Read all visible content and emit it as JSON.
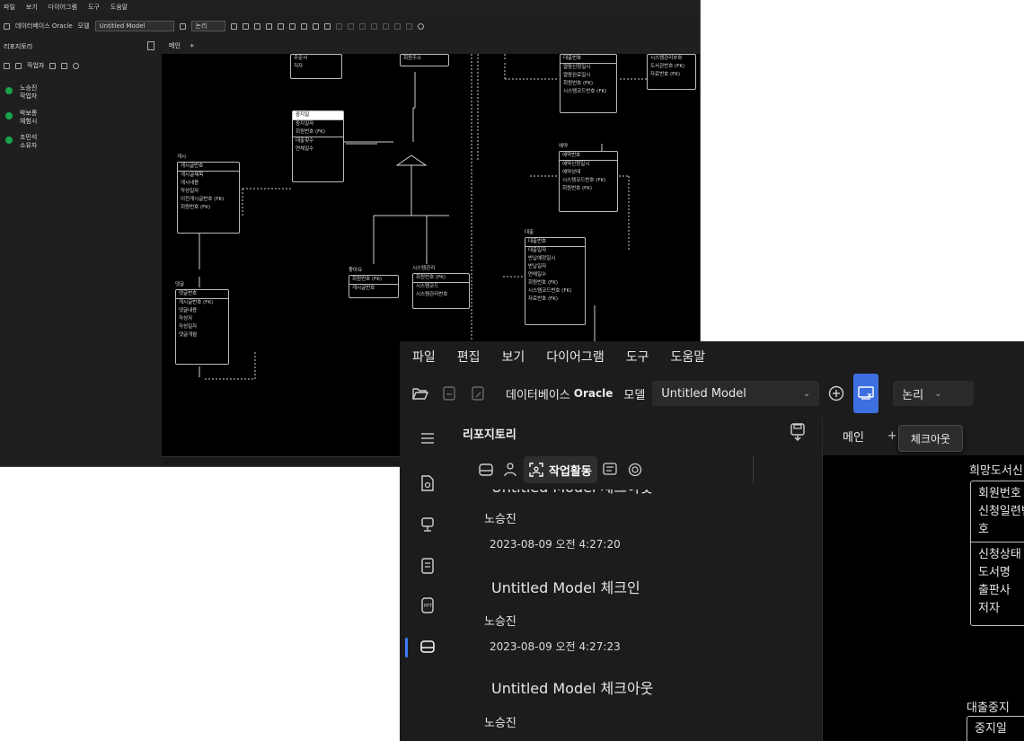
{
  "bg": {
    "menu": [
      "파일",
      "보기",
      "다이어그램",
      "도구",
      "도움말"
    ],
    "toolbar": {
      "database_label": "데이터베이스 Oracle",
      "model_label": "모델",
      "model_value": "Untitled Model",
      "logic": "논리"
    },
    "sidebar_title": "리포지토리",
    "active_tab": "작업자",
    "users": [
      {
        "line1": "노승진",
        "line2": "작업자"
      },
      {
        "line1": "박보롱",
        "line2": "체험시"
      },
      {
        "line1": "조민석",
        "line2": "소유자"
      }
    ],
    "tab": "메인",
    "entities": [
      {
        "title": "",
        "pk": "",
        "attrs": [
          "주문서",
          "저자"
        ]
      },
      {
        "title": "",
        "pk": "회원주소",
        "attrs": []
      },
      {
        "title": "",
        "pk": "대출번호",
        "attrs": [
          "열람신청일시",
          "열람완료일시",
          "회원번호 (FK)",
          "시스템코드번호 (FK)"
        ]
      },
      {
        "title": "",
        "pk": "",
        "attrs": [
          "시스템관리부호",
          "도서관번호 (FK)",
          "자료번호 (FK)"
        ]
      },
      {
        "title": "대출중지",
        "pk": "중지일",
        "attrs": [
          "중지일자",
          "회원번호 (FK)",
          "대출횟수",
          "연체일수"
        ]
      },
      {
        "title": "게시",
        "pk": "게시글번호",
        "attrs": [
          "게시글제목",
          "게시내용",
          "작성일자",
          "이전게시글번호 (FK)",
          "회원번호 (FK)"
        ]
      },
      {
        "title": "예약",
        "pk": "예약번호",
        "attrs": [
          "예약신청일시",
          "예약상태",
          "시스템코드번호 (FK)",
          "회원번호 (FK)"
        ]
      },
      {
        "title": "댓글",
        "pk": "댓글번호",
        "attrs": [
          "게시글번호 (FK)",
          "댓글내용",
          "작성자",
          "작성일자",
          "댓글개월"
        ]
      },
      {
        "title": "좋아요",
        "pk": "회원번호 (FK)",
        "attrs": [
          "게시글번호"
        ]
      },
      {
        "title": "시스템관리",
        "pk": "회원번호 (FK)",
        "attrs": [
          "시스템코드",
          "시스템관리번호"
        ]
      },
      {
        "title": "대출",
        "pk": "대출번호",
        "attrs": [
          "대출일자",
          "반납예정일시",
          "반납일자",
          "연체일수",
          "회원번호 (FK)",
          "시스템코드번호 (FK)",
          "자료번호 (FK)"
        ]
      }
    ]
  },
  "fg": {
    "menu": [
      "파일",
      "편집",
      "보기",
      "다이어그램",
      "도구",
      "도움말"
    ],
    "toolbar": {
      "database_label": "데이터베이스",
      "database_value": "Oracle",
      "model_label": "모델",
      "model_value": "Untitled Model",
      "logic_value": "논리"
    },
    "tooltip": "체크아웃",
    "panel": {
      "title": "리포지토리",
      "active_tab": "작업활동"
    },
    "activities": [
      {
        "title": "Untitled Model 체크아웃",
        "user": "노승진",
        "time": "2023-08-09 오전 4:27:20"
      },
      {
        "title": "Untitled Model 체크인",
        "user": "노승진",
        "time": "2023-08-09 오전 4:27:23"
      },
      {
        "title": "Untitled Model 체크아웃",
        "user": "노승진",
        "time": ""
      }
    ],
    "canvas_tab": "메인",
    "entity1": {
      "title": "희망도서신청",
      "pk_rows": [
        "회원번호",
        "신청일련번호"
      ],
      "attr_rows": [
        "신청상태",
        "도서명",
        "출판사",
        "저자"
      ]
    },
    "entity2": {
      "title": "대출중지",
      "pk_rows": [
        "중지일"
      ]
    }
  }
}
